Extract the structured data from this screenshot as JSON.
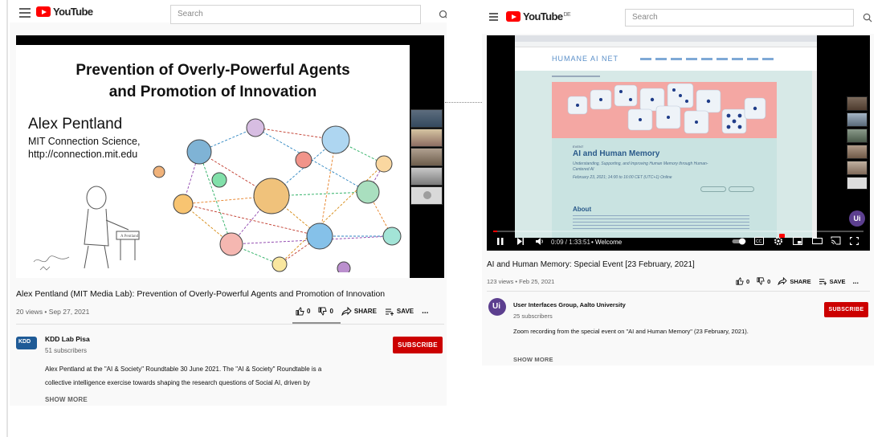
{
  "left": {
    "search": {
      "placeholder": "Search"
    },
    "logo": {
      "text": "YouTube"
    },
    "slide": {
      "title_line1": "Prevention of Overly-Powerful Agents",
      "title_line2": "and Promotion of Innovation",
      "name": "Alex Pentland",
      "affiliation1": "MIT Connection Science,",
      "affiliation2": "http://connection.mit.edu"
    },
    "title": "Alex Pentland (MIT Media Lab): Prevention of Overly-Powerful Agents and Promotion of Innovation",
    "meta": "20 views • Sep 27, 2021",
    "actions": {
      "likes": "0",
      "dislikes": "0",
      "share": "SHARE",
      "save": "SAVE",
      "more": "..."
    },
    "channel": {
      "name": "KDD Lab Pisa",
      "subscribers": "51 subscribers",
      "subscribe": "SUBSCRIBE",
      "icon_text": "KDD"
    },
    "description": {
      "line1": "Alex Pentland at the \"AI & Society\" Roundtable 30 June 2021. The \"AI & Society\" Roundtable is a",
      "line2": "collective intelligence exercise towards shaping the research questions of Social AI, driven by"
    },
    "show_more": "SHOW MORE"
  },
  "right": {
    "search": {
      "placeholder": "Search"
    },
    "logo": {
      "text": "YouTube",
      "country": "DE"
    },
    "player": {
      "site_logo": "HUMANE AI NET",
      "event_label": "EVENT",
      "event_title": "AI and Human Memory",
      "event_subtitle": "Understanding, Supporting, and Improving Human Memory through Human-Centered AI",
      "event_date": "February 23, 2021; 14:00 to 16:00 CET (UTC+1) Online",
      "about": "About",
      "time": "0:09 / 1:33:51",
      "chapter": "• Welcome",
      "avatar_text": "Ui"
    },
    "title": "AI and Human Memory: Special Event [23 February, 2021]",
    "meta": "123 views • Feb 25, 2021",
    "actions": {
      "likes": "0",
      "dislikes": "0",
      "share": "SHARE",
      "save": "SAVE",
      "more": "..."
    },
    "channel": {
      "name": "User Interfaces Group, Aalto University",
      "subscribers": "25 subscribers",
      "subscribe": "SUBSCRIBE",
      "icon_text": "Ui"
    },
    "description": "Zoom recording from the special event on \"AI and Human Memory\" (23 February, 2021).",
    "show_more": "SHOW MORE"
  },
  "colors": {
    "brand_red": "#ff0000",
    "subscribe_red": "#cc0000",
    "aalto_purple": "#5c3f8f",
    "slide_pink": "#f4a7a3"
  },
  "icons": [
    "menu-icon",
    "search-icon",
    "thumbs-up-icon",
    "thumbs-down-icon",
    "share-icon",
    "save-icon",
    "more-icon",
    "play-icon",
    "next-icon",
    "volume-icon",
    "autoplay-icon",
    "captions-icon",
    "settings-icon",
    "miniplayer-icon",
    "theater-icon",
    "cast-icon",
    "fullscreen-icon"
  ]
}
